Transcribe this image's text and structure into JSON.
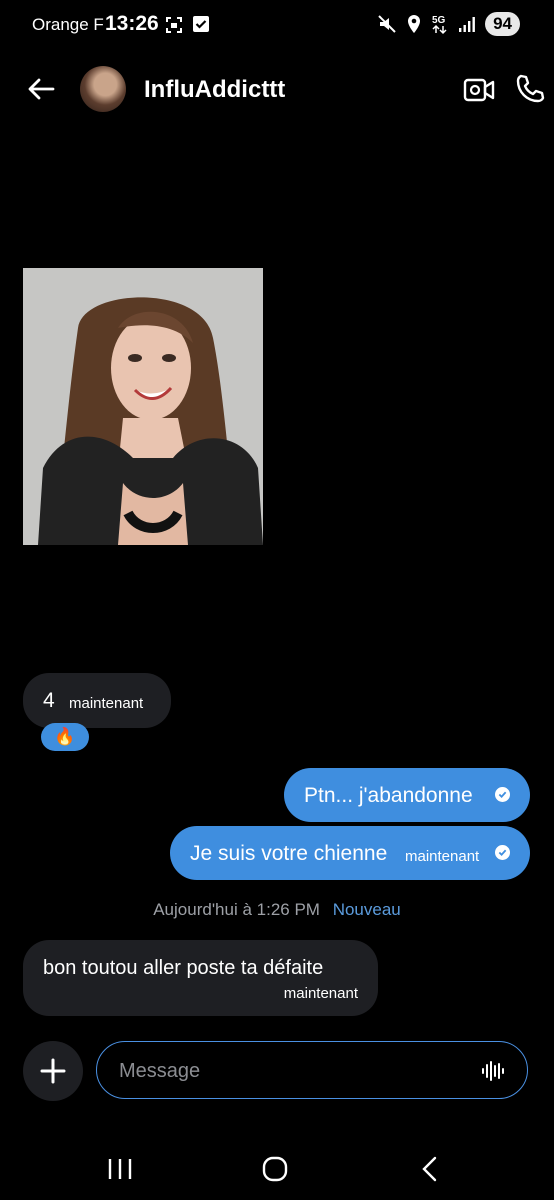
{
  "status_bar": {
    "carrier": "Orange F",
    "time": "13:26",
    "network": "5G",
    "battery": "94"
  },
  "header": {
    "contact_name": "InfluAddicttt",
    "icons": [
      "back-arrow-icon",
      "video-camera-icon",
      "phone-icon"
    ]
  },
  "messages": {
    "incoming_number": "4",
    "incoming_number_time": "maintenant",
    "reaction": "🔥",
    "outgoing_1": "Ptn... j'abandonne",
    "outgoing_2": "Je suis votre chienne",
    "outgoing_2_time": "maintenant",
    "day_label": "Aujourd'hui à 1:26 PM",
    "new_label": "Nouveau",
    "incoming_last": "bon toutou aller poste ta défaite",
    "incoming_last_time": "maintenant"
  },
  "composer": {
    "placeholder": "Message"
  },
  "colors": {
    "background": "#000000",
    "outgoing_bubble": "#3f8edf",
    "incoming_bubble": "#1e1f23",
    "accent": "#5b9bdc"
  }
}
